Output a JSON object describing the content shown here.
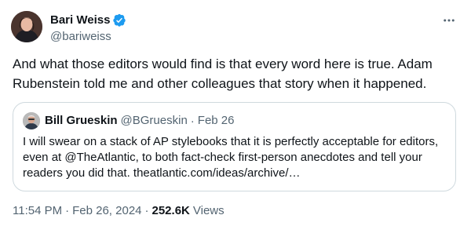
{
  "author": {
    "name": "Bari Weiss",
    "handle": "@bariweiss",
    "verified_icon": "verified-badge-icon",
    "badge_color": "#1d9bf0"
  },
  "post": {
    "text": "And what those editors would find is that every word here is true. Adam Rubenstein told me and other colleagues that story when it happened.",
    "time": "11:54 PM",
    "date": "Feb 26, 2024",
    "views_count": "252.6K",
    "views_label": "Views",
    "separator": "·"
  },
  "quote": {
    "name": "Bill Grueskin",
    "handle": "@BGrueskin",
    "separator": "·",
    "date": "Feb 26",
    "text": "I will swear on a stack of AP stylebooks that it is perfectly acceptable for editors, even at @TheAtlantic, to both fact-check first-person anecdotes and tell your readers you did that. theatlantic.com/ideas/archive/…"
  },
  "menu": {
    "icon": "more-horizontal-icon"
  }
}
